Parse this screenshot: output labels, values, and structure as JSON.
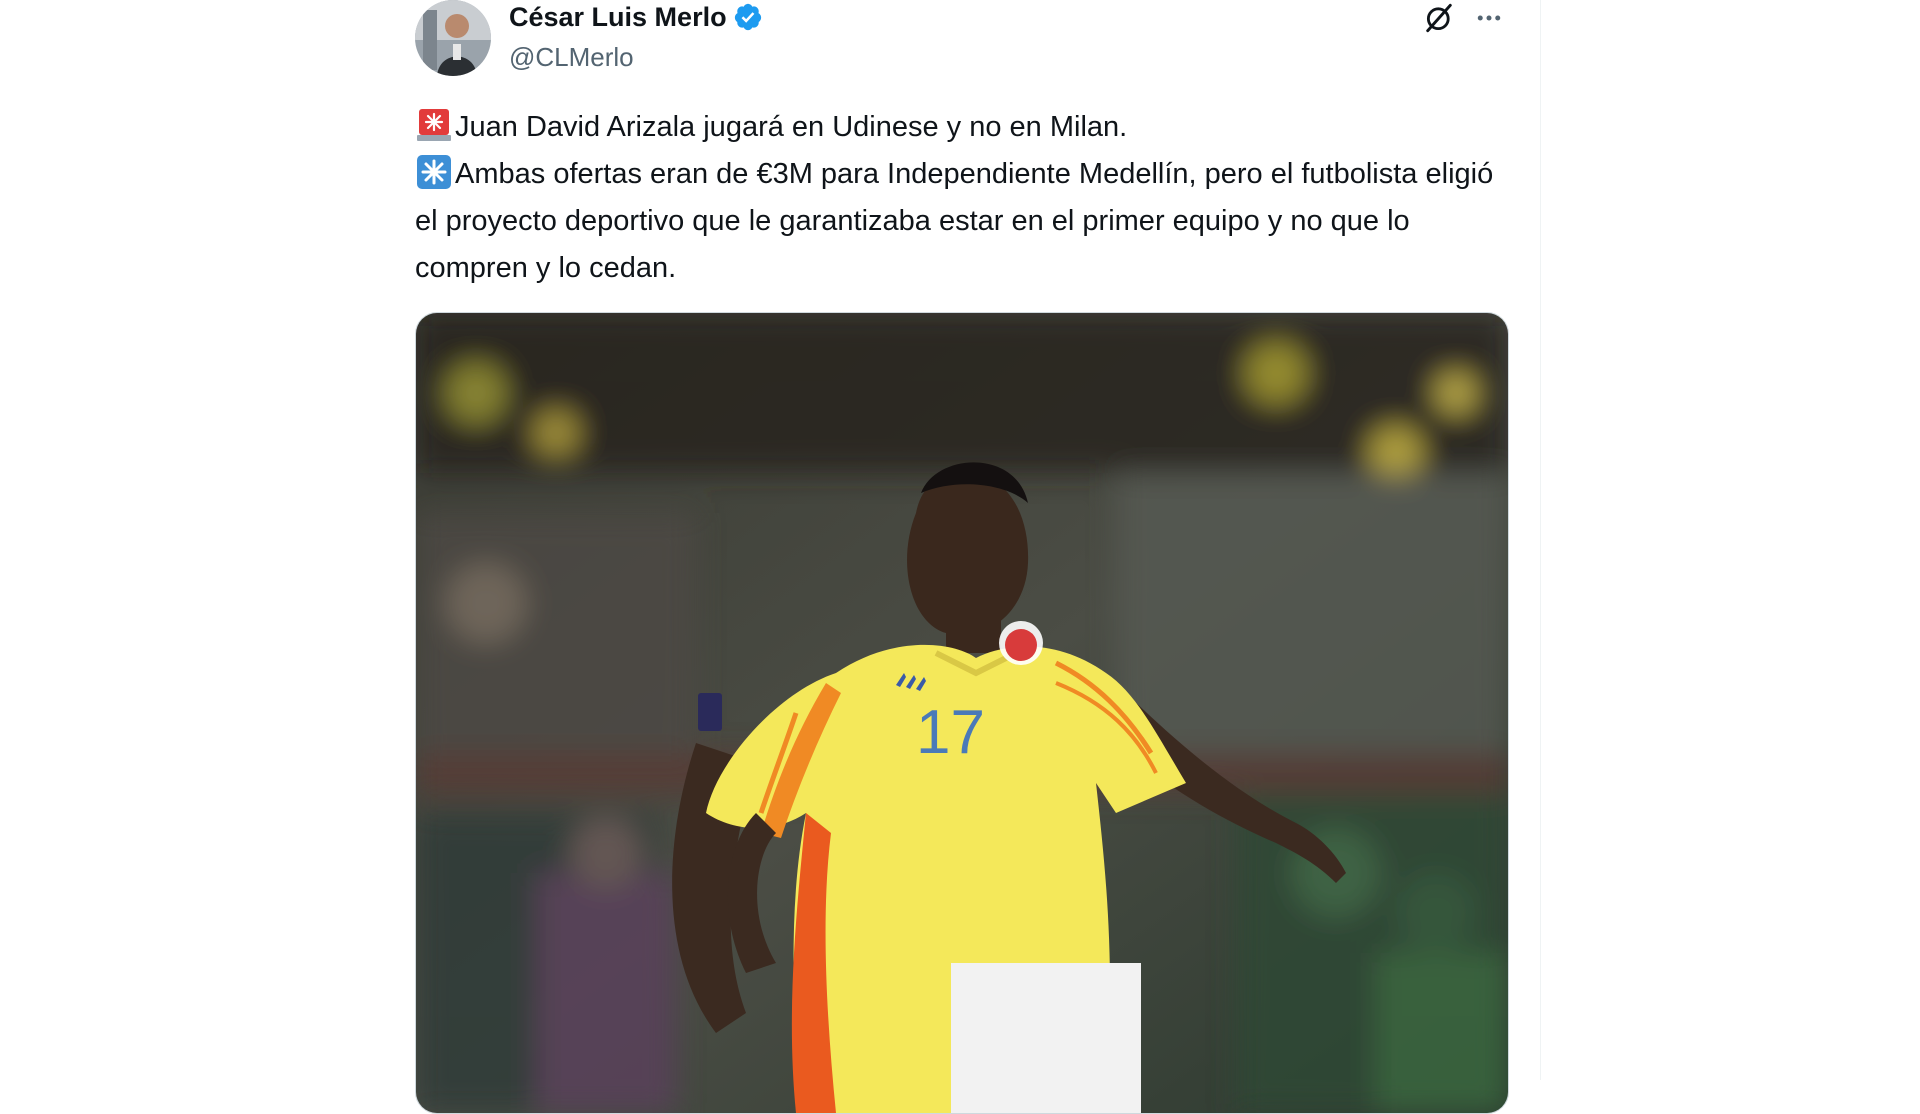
{
  "author": {
    "name": "César Luis Merlo",
    "handle": "@CLMerlo",
    "verified": true,
    "verified_color": "#1d9bf0"
  },
  "actions": {
    "grok_icon": "grok-icon",
    "more_icon": "more-horizontal-icon"
  },
  "tweet": {
    "line1_emoji": "police-light-emoji",
    "line1": "Juan David Arizala jugará en Udinese y no en Milan.",
    "line2_emoji": "eight-spoked-asterisk-emoji",
    "line2": "Ambas ofertas eran de €3M para Independiente Medellín, pero el futbolista eligió el proyecto deportivo que le garantizaba estar en el primer equipo y no que lo compren y lo cedan."
  },
  "media": {
    "jersey_number": "17",
    "jersey_color": "#f4e85a"
  }
}
